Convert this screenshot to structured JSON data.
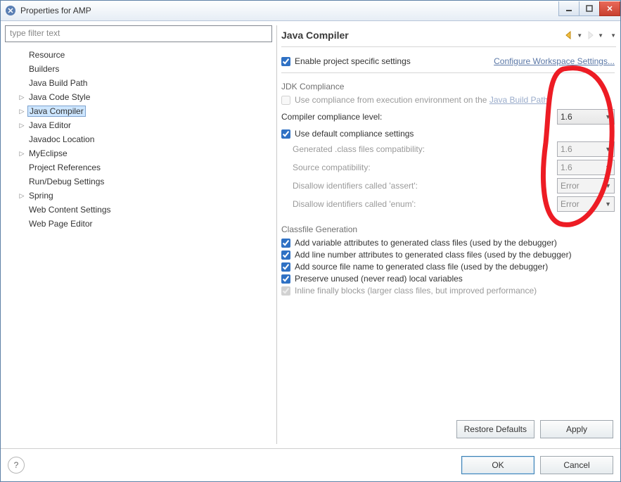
{
  "window": {
    "title": "Properties for AMP"
  },
  "filter": {
    "placeholder": "type filter text"
  },
  "tree": {
    "items": [
      {
        "label": "Resource",
        "expandable": false,
        "indent": 1
      },
      {
        "label": "Builders",
        "expandable": false,
        "indent": 1
      },
      {
        "label": "Java Build Path",
        "expandable": false,
        "indent": 1
      },
      {
        "label": "Java Code Style",
        "expandable": true,
        "indent": 1
      },
      {
        "label": "Java Compiler",
        "expandable": true,
        "indent": 1,
        "selected": true
      },
      {
        "label": "Java Editor",
        "expandable": true,
        "indent": 1
      },
      {
        "label": "Javadoc Location",
        "expandable": false,
        "indent": 1
      },
      {
        "label": "MyEclipse",
        "expandable": true,
        "indent": 1
      },
      {
        "label": "Project References",
        "expandable": false,
        "indent": 1
      },
      {
        "label": "Run/Debug Settings",
        "expandable": false,
        "indent": 1
      },
      {
        "label": "Spring",
        "expandable": true,
        "indent": 1
      },
      {
        "label": "Web Content Settings",
        "expandable": false,
        "indent": 1
      },
      {
        "label": "Web Page Editor",
        "expandable": false,
        "indent": 1
      }
    ]
  },
  "page": {
    "title": "Java Compiler",
    "enable_project_specific": "Enable project specific settings",
    "configure_workspace_link": "Configure Workspace Settings...",
    "jdk_compliance": {
      "title": "JDK Compliance",
      "use_exec_env": "Use compliance from execution environment on the ",
      "use_exec_env_link": "Java Build Path",
      "compliance_level_label": "Compiler compliance level:",
      "compliance_level_value": "1.6",
      "use_default_label": "Use default compliance settings",
      "generated_class_label": "Generated .class files compatibility:",
      "generated_class_value": "1.6",
      "source_compat_label": "Source compatibility:",
      "source_compat_value": "1.6",
      "disallow_assert_label": "Disallow identifiers called 'assert':",
      "disallow_assert_value": "Error",
      "disallow_enum_label": "Disallow identifiers called 'enum':",
      "disallow_enum_value": "Error"
    },
    "classfile": {
      "title": "Classfile Generation",
      "add_variable": "Add variable attributes to generated class files (used by the debugger)",
      "add_line": "Add line number attributes to generated class files (used by the debugger)",
      "add_source": "Add source file name to generated class file (used by the debugger)",
      "preserve_unused": "Preserve unused (never read) local variables",
      "inline_finally": "Inline finally blocks (larger class files, but improved performance)"
    },
    "restore_defaults": "Restore Defaults",
    "apply": "Apply"
  },
  "footer": {
    "ok": "OK",
    "cancel": "Cancel"
  }
}
